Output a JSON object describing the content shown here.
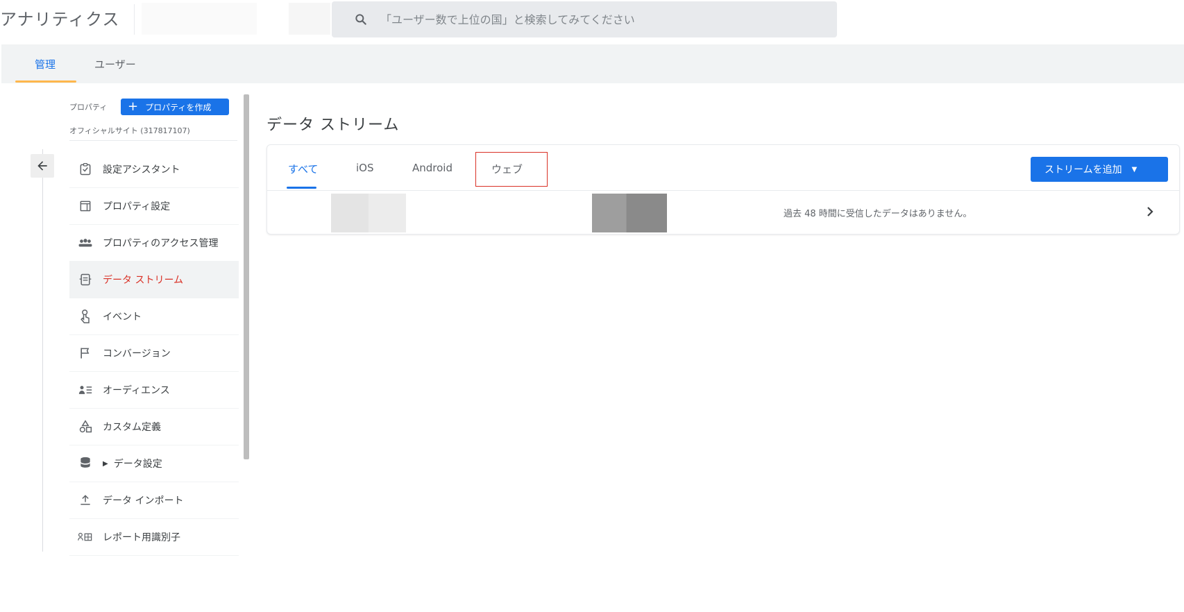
{
  "app": {
    "title": "アナリティクス"
  },
  "search": {
    "placeholder": "「ユーザー数で上位の国」と検索してみてください",
    "icon": "search-icon"
  },
  "admin_tabs": [
    {
      "label": "管理",
      "active": true
    },
    {
      "label": "ユーザー",
      "active": false
    }
  ],
  "sidebar": {
    "property_label": "プロパティ",
    "create_property_label": "プロパティを作成",
    "property_name": "オフィシャルサイト (317817107)",
    "items": [
      {
        "label": "設定アシスタント",
        "icon": "checklist-icon"
      },
      {
        "label": "プロパティ設定",
        "icon": "property-settings-icon"
      },
      {
        "label": "プロパティのアクセス管理",
        "icon": "people-icon"
      },
      {
        "label": "データ ストリーム",
        "icon": "data-stream-icon",
        "active": true
      },
      {
        "label": "イベント",
        "icon": "touch-icon"
      },
      {
        "label": "コンバージョン",
        "icon": "flag-icon"
      },
      {
        "label": "オーディエンス",
        "icon": "audience-icon"
      },
      {
        "label": "カスタム定義",
        "icon": "shapes-icon"
      },
      {
        "label": "データ設定",
        "icon": "database-icon",
        "expandable": true
      },
      {
        "label": "データ インポート",
        "icon": "upload-icon"
      },
      {
        "label": "レポート用識別子",
        "icon": "identifier-icon"
      }
    ]
  },
  "main": {
    "title": "データ ストリーム",
    "tabs": [
      {
        "label": "すべて",
        "active": true
      },
      {
        "label": "iOS"
      },
      {
        "label": "Android"
      },
      {
        "label": "ウェブ",
        "highlighted": true
      }
    ],
    "add_stream_label": "ストリームを追加",
    "stream_row": {
      "status": "過去 48 時間に受信したデータはありません。"
    }
  },
  "colors": {
    "accent": "#1a73e8",
    "active_nav": "#d93025",
    "highlight_border": "#d93025",
    "tab_indicator": "#ffb74d"
  }
}
